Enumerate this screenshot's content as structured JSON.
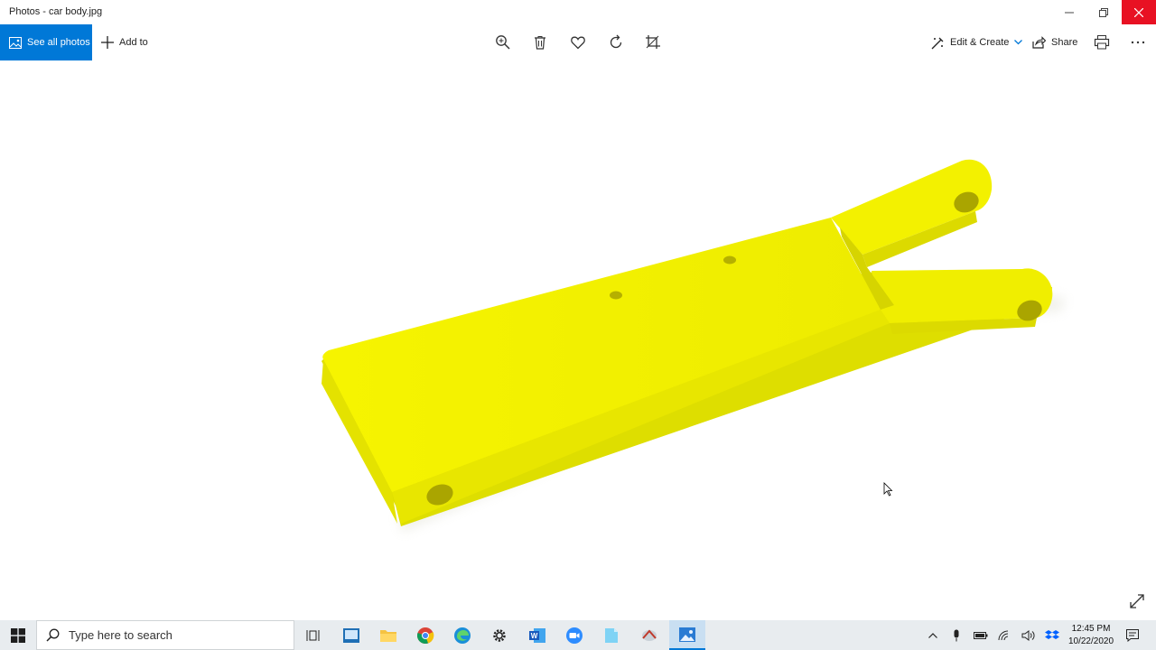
{
  "window": {
    "title": "Photos - car body.jpg"
  },
  "toolbar": {
    "see_all_photos": "See all photos",
    "add_to": "Add to",
    "edit_create": "Edit & Create",
    "share": "Share"
  },
  "taskbar": {
    "search_placeholder": "Type here to search",
    "time": "12:45 PM",
    "date": "10/22/2020"
  },
  "colors": {
    "accent": "#0078d7",
    "close_hover": "#e81123",
    "part_yellow": "#f2f000"
  }
}
